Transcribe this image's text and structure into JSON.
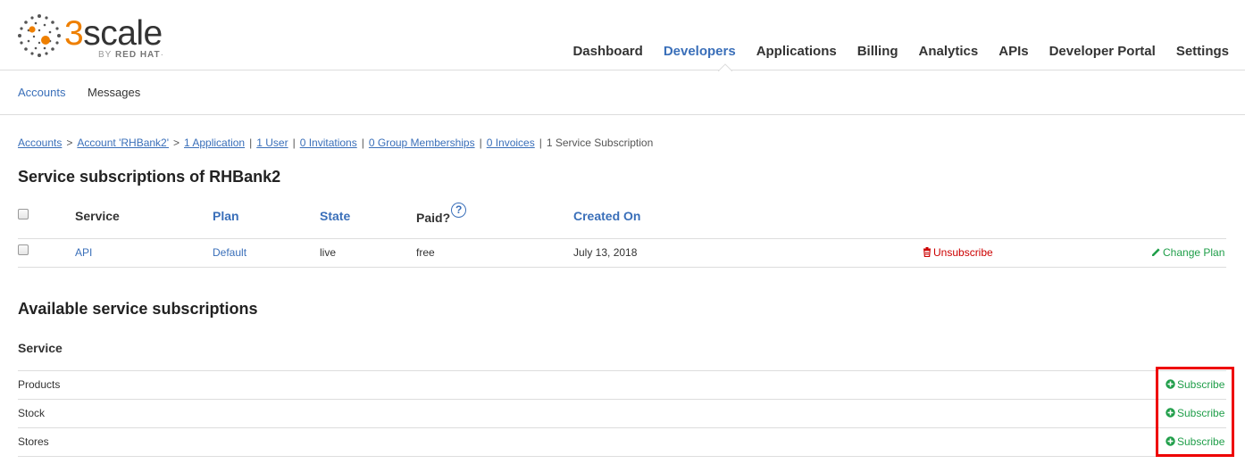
{
  "brand": {
    "name_prefix": "3",
    "name_suffix": "scale",
    "byline_prefix": "BY ",
    "byline_brand": "RED HAT",
    "byline_mark": "·",
    "accent_color": "#ee7f00"
  },
  "main_nav": {
    "items": [
      "Dashboard",
      "Developers",
      "Applications",
      "Billing",
      "Analytics",
      "APIs",
      "Developer Portal",
      "Settings"
    ],
    "active": "Developers"
  },
  "sub_nav": {
    "accounts": "Accounts",
    "messages": "Messages"
  },
  "breadcrumb": {
    "accounts": "Accounts",
    "sep": ">",
    "account": "Account 'RHBank2'",
    "pipe": "|",
    "application": "1 Application",
    "user": "1 User",
    "invitations": "0 Invitations",
    "group_memberships": "0 Group Memberships",
    "invoices": "0 Invoices",
    "current": "1 Service Subscription"
  },
  "subscriptions": {
    "title": "Service subscriptions of RHBank2",
    "headers": {
      "service": "Service",
      "plan": "Plan",
      "state": "State",
      "paid": "Paid?",
      "created_on": "Created On",
      "help": "?"
    },
    "rows": [
      {
        "service": "API",
        "plan": "Default",
        "state": "live",
        "paid": "free",
        "created_on": "July 13, 2018",
        "unsubscribe": "Unsubscribe",
        "change_plan": "Change Plan"
      }
    ]
  },
  "available": {
    "title": "Available service subscriptions",
    "header_service": "Service",
    "rows": [
      {
        "service": "Products",
        "action": "Subscribe"
      },
      {
        "service": "Stock",
        "action": "Subscribe"
      },
      {
        "service": "Stores",
        "action": "Subscribe"
      }
    ]
  },
  "colors": {
    "link": "#3a6fb9",
    "danger": "#cc0000",
    "success": "#1f9e49",
    "highlight": "#ee0000"
  }
}
